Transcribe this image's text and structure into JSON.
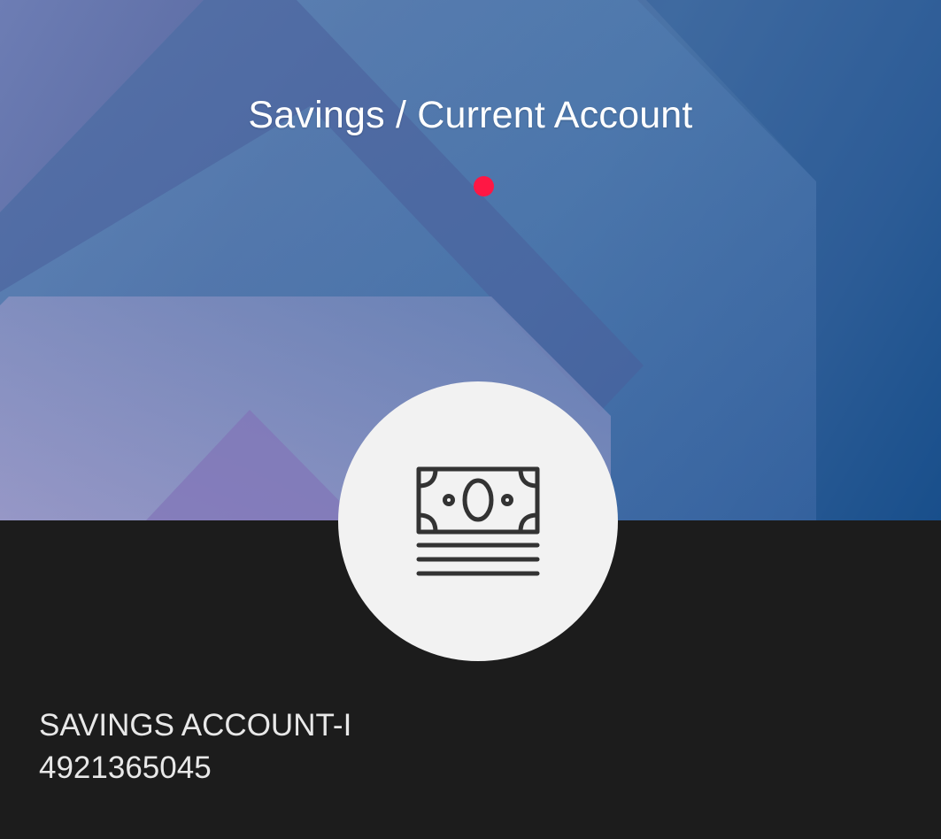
{
  "header": {
    "title": "Savings / Current Account"
  },
  "pager": {
    "active_index": 0,
    "dot_color": "#ff1744"
  },
  "account": {
    "icon": "banknote-stack-icon",
    "name": "SAVINGS ACCOUNT-I",
    "number": "4921365045"
  },
  "colors": {
    "hero_primary": "#4a73a6",
    "hero_dark": "#0f4a86",
    "panel_background": "#1c1c1c",
    "icon_circle": "#f2f2f2"
  }
}
